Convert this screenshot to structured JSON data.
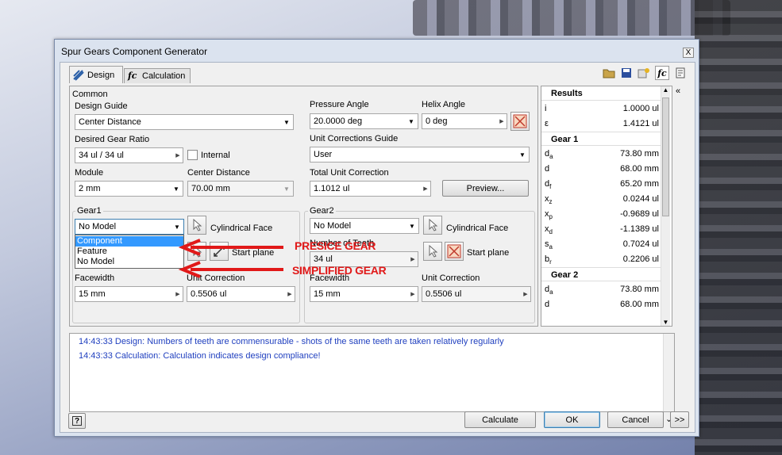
{
  "window": {
    "title": "Spur Gears Component Generator",
    "close_label": "X"
  },
  "tabs": [
    {
      "label": "Design"
    },
    {
      "label": "Calculation"
    }
  ],
  "common": {
    "title": "Common",
    "design_guide": {
      "label": "Design Guide",
      "value": "Center Distance"
    },
    "desired_gear_ratio": {
      "label": "Desired Gear Ratio",
      "value": "34 ul / 34 ul"
    },
    "internal": {
      "label": "Internal",
      "checked": false
    },
    "module": {
      "label": "Module",
      "value": "2 mm"
    },
    "center_distance": {
      "label": "Center Distance",
      "value": "70.00 mm"
    },
    "pressure_angle": {
      "label": "Pressure Angle",
      "value": "20.0000 deg"
    },
    "helix_angle": {
      "label": "Helix Angle",
      "value": "0 deg"
    },
    "unit_corrections_guide": {
      "label": "Unit Corrections Guide",
      "value": "User"
    },
    "total_unit_correction": {
      "label": "Total Unit Correction",
      "value": "1.1012 ul"
    },
    "preview_button": "Preview..."
  },
  "gear1": {
    "title": "Gear1",
    "model": "No Model",
    "cylindrical_face": "Cylindrical Face",
    "start_plane": "Start plane",
    "facewidth": {
      "label": "Facewidth",
      "value": "15 mm"
    },
    "unit_correction": {
      "label": "Unit Correction",
      "value": "0.5506 ul"
    },
    "dropdown_options": [
      "Component",
      "Feature",
      "No Model"
    ],
    "dropdown_selected": "Component"
  },
  "gear2": {
    "title": "Gear2",
    "model": "No Model",
    "cylindrical_face": "Cylindrical Face",
    "number_of_teeth": {
      "label": "Number of Teeth",
      "value": "34 ul"
    },
    "start_plane": "Start plane",
    "facewidth": {
      "label": "Facewidth",
      "value": "15 mm"
    },
    "unit_correction": {
      "label": "Unit Correction",
      "value": "0.5506 ul"
    }
  },
  "results": {
    "title": "Results",
    "common_rows": [
      {
        "sym": "i",
        "val": "1.0000 ul"
      },
      {
        "sym": "ε",
        "val": "1.4121 ul"
      }
    ],
    "gear1_title": "Gear 1",
    "gear1_rows": [
      {
        "sym": "d",
        "sub": "a",
        "val": "73.80 mm"
      },
      {
        "sym": "d",
        "sub": "",
        "val": "68.00 mm"
      },
      {
        "sym": "d",
        "sub": "f",
        "val": "65.20 mm"
      },
      {
        "sym": "x",
        "sub": "z",
        "val": "0.0244 ul"
      },
      {
        "sym": "x",
        "sub": "p",
        "val": "-0.9689 ul"
      },
      {
        "sym": "x",
        "sub": "d",
        "val": "-1.1389 ul"
      },
      {
        "sym": "s",
        "sub": "a",
        "val": "0.7024 ul"
      },
      {
        "sym": "b",
        "sub": "r",
        "val": "0.2206 ul"
      }
    ],
    "gear2_title": "Gear 2",
    "gear2_rows": [
      {
        "sym": "d",
        "sub": "a",
        "val": "73.80 mm"
      },
      {
        "sym": "d",
        "sub": "",
        "val": "68.00 mm"
      }
    ]
  },
  "log": [
    "14:43:33 Design: Numbers of teeth are commensurable - shots of the same teeth are taken relatively regularly",
    "14:43:33 Calculation: Calculation indicates design compliance!"
  ],
  "buttons": {
    "calculate": "Calculate",
    "ok": "OK",
    "cancel": "Cancel",
    "more": ">>"
  },
  "annotations": {
    "presice": "PRESICE GEAR",
    "simplified": "SIMPLIFIED GEAR"
  },
  "colors": {
    "annotation": "#e11919",
    "log_text": "#1f3fbf",
    "selection": "#3399ff"
  }
}
